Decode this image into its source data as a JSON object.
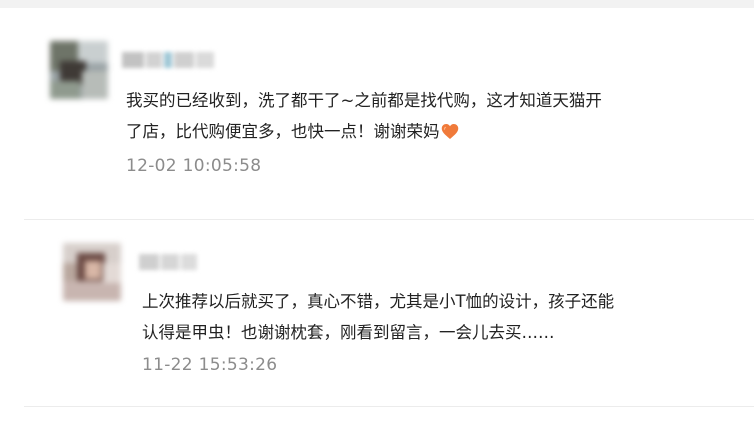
{
  "comments": [
    {
      "text_line1": "我买的已经收到，洗了都干了~之前都是找代购，这才知道天猫开",
      "text_line2": "了店，比代购便宜多，也快一点！谢谢荣妈",
      "emoji": "orange-heart-icon",
      "time": "12-02 10:05:58"
    },
    {
      "text_line1": "上次推荐以后就买了，真心不错，尤其是小T恤的设计，孩子还能",
      "text_line2": "认得是甲虫！也谢谢枕套，刚看到留言，一会儿去买……",
      "time": "11-22 15:53:26"
    }
  ],
  "colors": {
    "text": "#222222",
    "timestamp": "#8c8c8c",
    "heart": "#f07a3a",
    "divider": "#ececec"
  }
}
